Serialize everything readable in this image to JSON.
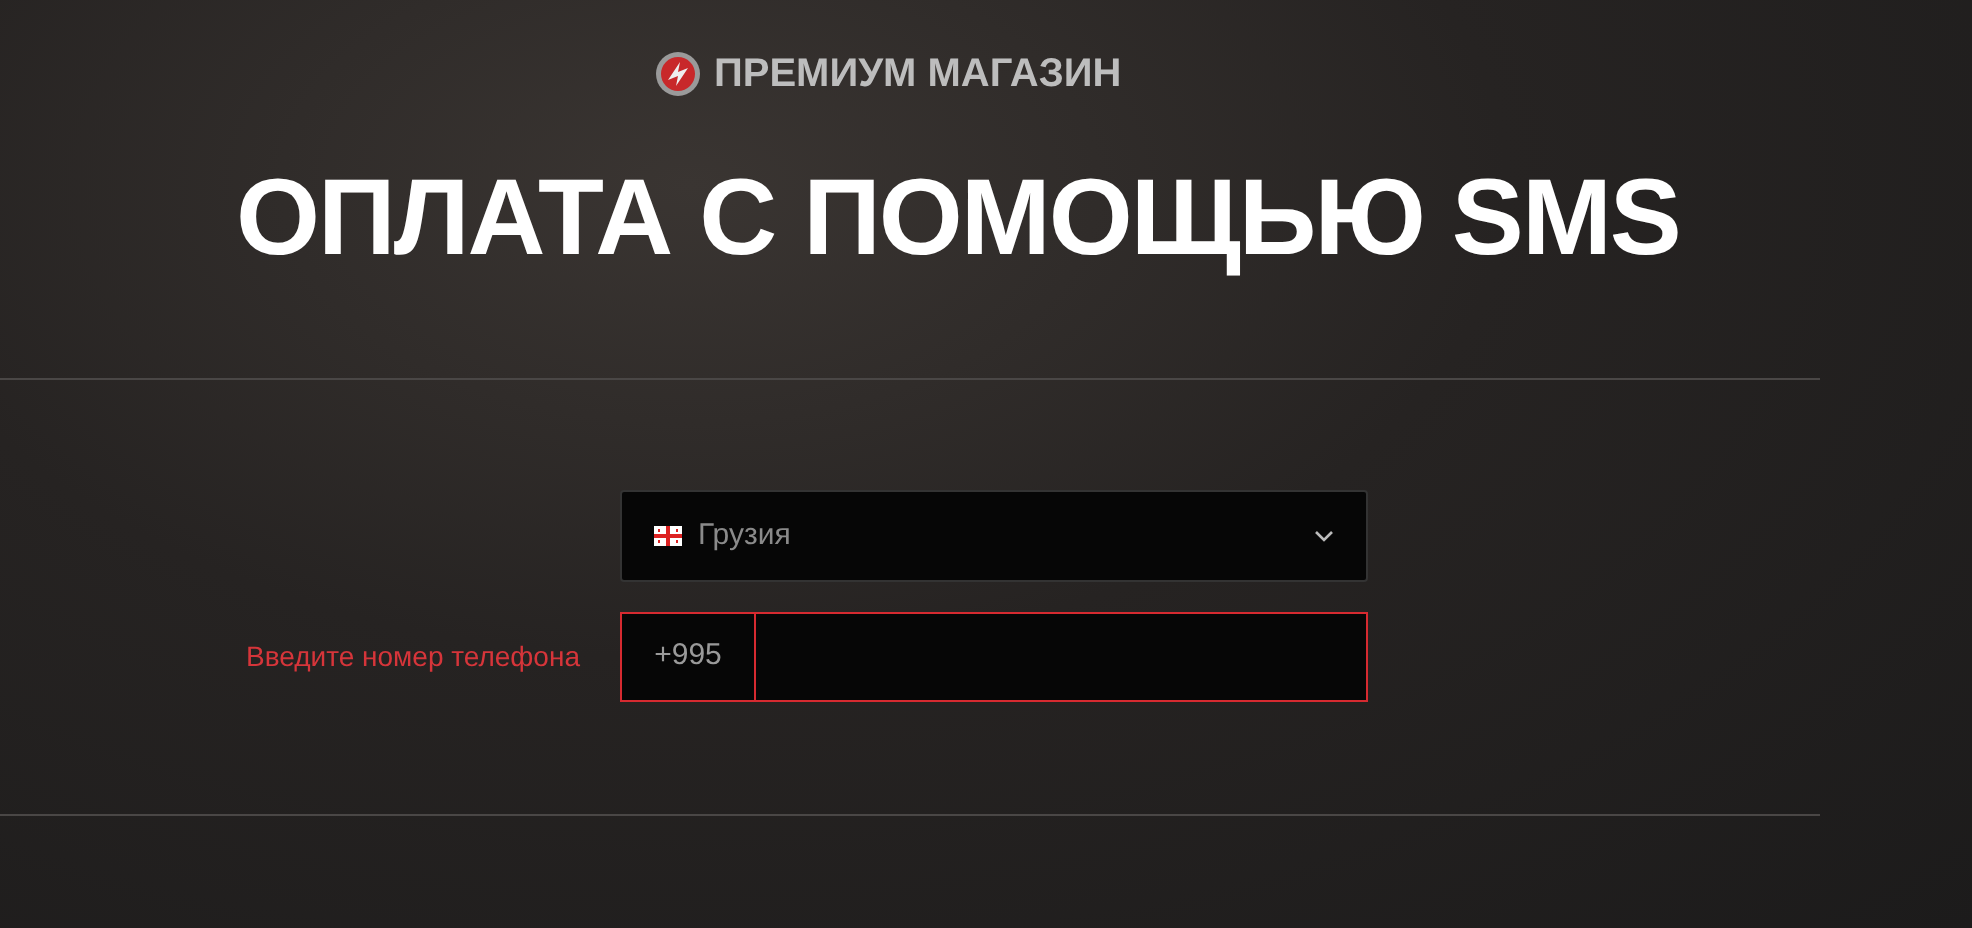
{
  "header": {
    "brand": "ПРЕМИУМ МАГАЗИН"
  },
  "title": "ОПЛАТА С ПОМОЩЬЮ SMS",
  "country_select": {
    "value": "Грузия"
  },
  "phone": {
    "label": "Введите номер телефона",
    "prefix": "+995",
    "error": true
  }
}
